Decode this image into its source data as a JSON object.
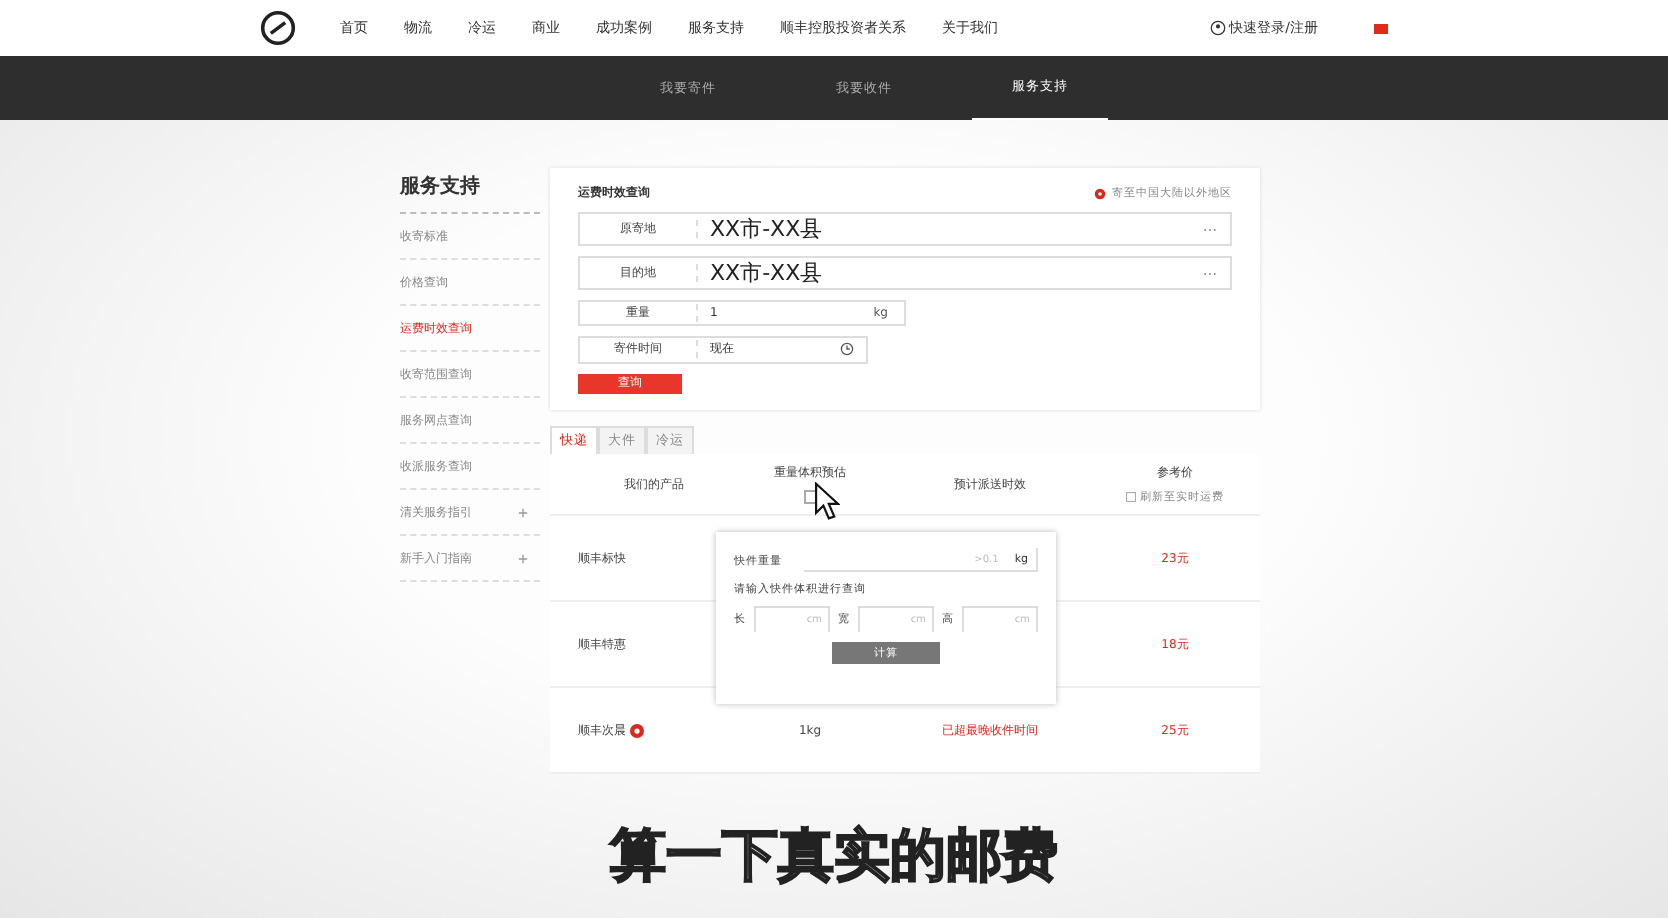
{
  "nav": {
    "items": [
      "首页",
      "物流",
      "冷运",
      "商业",
      "成功案例",
      "服务支持",
      "顺丰控股投资者关系",
      "关于我们"
    ],
    "login": "快速登录/注册"
  },
  "subnav": [
    {
      "label": "我要寄件",
      "selected": false
    },
    {
      "label": "我要收件",
      "selected": false
    },
    {
      "label": "服务支持",
      "selected": true
    }
  ],
  "sidebar": {
    "title": "服务支持",
    "items": [
      {
        "label": "收寄标准",
        "selected": false,
        "expandable": false
      },
      {
        "label": "价格查询",
        "selected": false,
        "expandable": false
      },
      {
        "label": "运费时效查询",
        "selected": true,
        "expandable": false
      },
      {
        "label": "收寄范围查询",
        "selected": false,
        "expandable": false
      },
      {
        "label": "服务网点查询",
        "selected": false,
        "expandable": false
      },
      {
        "label": "收派服务查询",
        "selected": false,
        "expandable": false
      },
      {
        "label": "清关服务指引",
        "selected": false,
        "expandable": true
      },
      {
        "label": "新手入门指南",
        "selected": false,
        "expandable": true
      }
    ]
  },
  "query": {
    "title": "运费时效查询",
    "notice": "寄至中国大陆以外地区",
    "fields": [
      {
        "kind": "place",
        "label": "原寄地",
        "value": "XX市-XX县"
      },
      {
        "kind": "place",
        "label": "目的地",
        "value": "XX市-XX县"
      },
      {
        "kind": "weight",
        "label": "重量",
        "value": "1",
        "unit": "kg"
      },
      {
        "kind": "time",
        "label": "寄件时间",
        "value": "现在"
      }
    ],
    "button": "查询"
  },
  "product_tabs": [
    {
      "label": "快递",
      "selected": true
    },
    {
      "label": "大件",
      "selected": false
    },
    {
      "label": "冷运",
      "selected": false
    }
  ],
  "table": {
    "columns": [
      {
        "title": "我们的产品"
      },
      {
        "title": "重量体积预估",
        "checked": false
      },
      {
        "title": "预计派送时效"
      },
      {
        "title": "参考价",
        "subtitle": "刷新至实时运费"
      }
    ],
    "rows": [
      {
        "product": "顺丰标快",
        "price": "23元",
        "badge": false
      },
      {
        "product": "顺丰特惠",
        "price": "18元",
        "badge": false
      },
      {
        "product": "顺丰次晨",
        "weight": "1kg",
        "note": "已超最晚收件时间",
        "price": "25元",
        "badge": true
      }
    ]
  },
  "popup": {
    "weight_label": "快件重量",
    "weight_placeholder": ">0.1",
    "weight_unit": "kg",
    "volume_hint": "请输入快件体积进行查询",
    "dims": [
      {
        "label": "长",
        "unit": "cm"
      },
      {
        "label": "宽",
        "unit": "cm"
      },
      {
        "label": "高",
        "unit": "cm"
      }
    ],
    "button": "计算"
  },
  "subtitle": "算一下真实的邮费"
}
